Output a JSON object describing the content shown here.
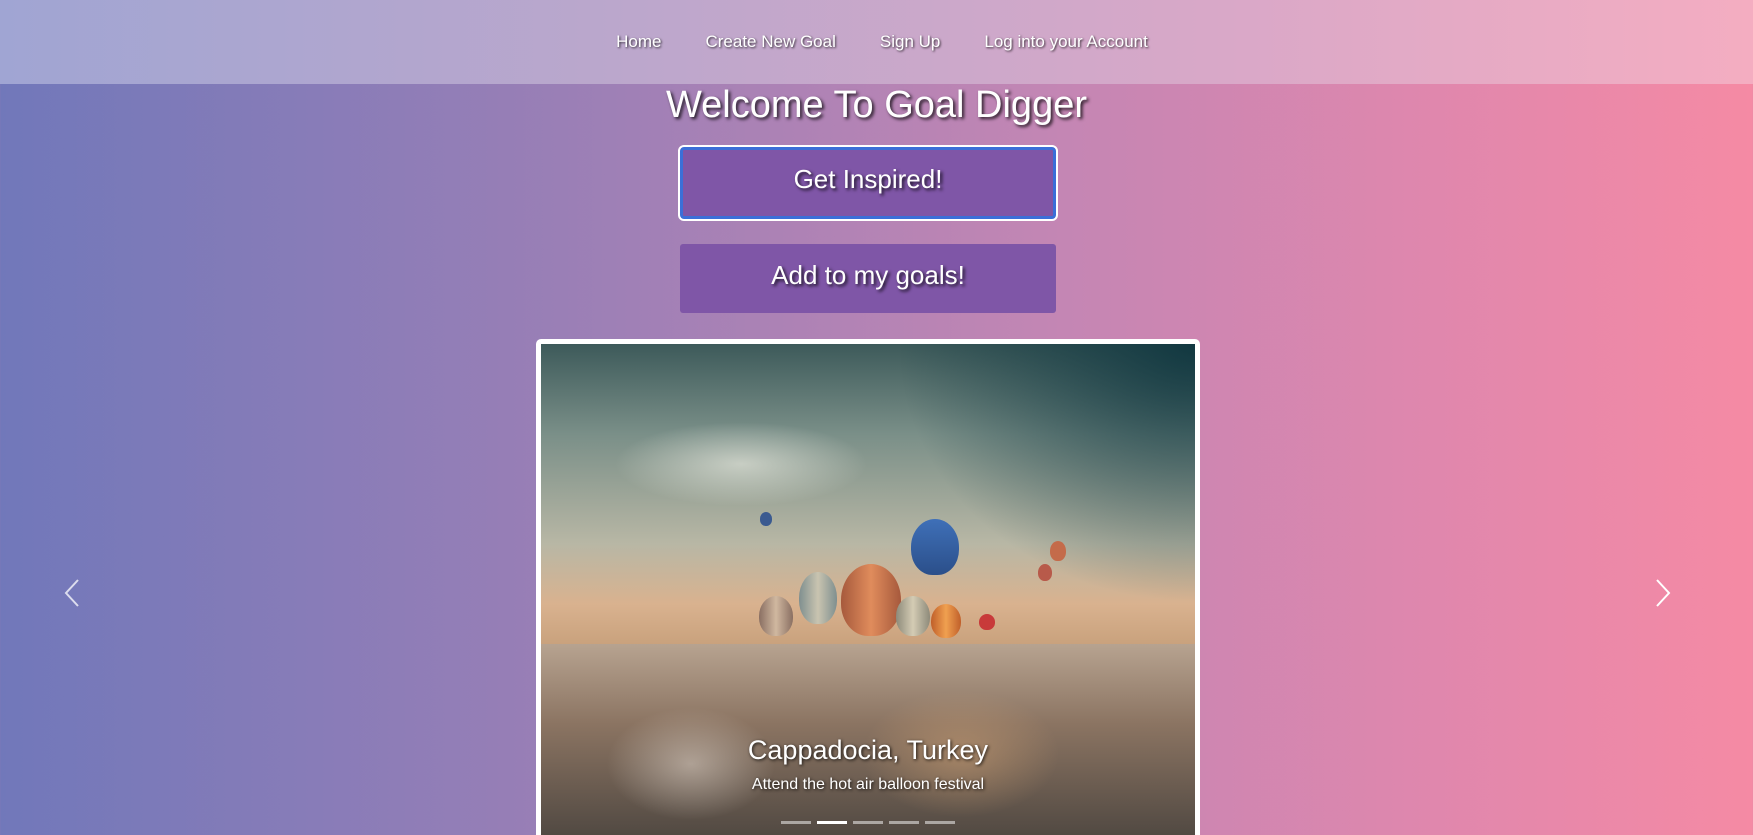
{
  "nav": {
    "links": [
      "Home",
      "Create New Goal",
      "Sign Up",
      "Log into your Account"
    ]
  },
  "page": {
    "title": "Welcome To Goal Digger"
  },
  "buttons": {
    "inspire": "Get Inspired!",
    "add": "Add to my goals!"
  },
  "carousel": {
    "active_index": 1,
    "slide_count": 5,
    "caption_title": "Cappadocia, Turkey",
    "caption_text": "Attend the hot air balloon festival",
    "prev_icon": "chevron-left-icon",
    "next_icon": "chevron-right-icon"
  },
  "colors": {
    "button_bg": "#7f56a7",
    "focus_ring": "#3b6fd8"
  }
}
